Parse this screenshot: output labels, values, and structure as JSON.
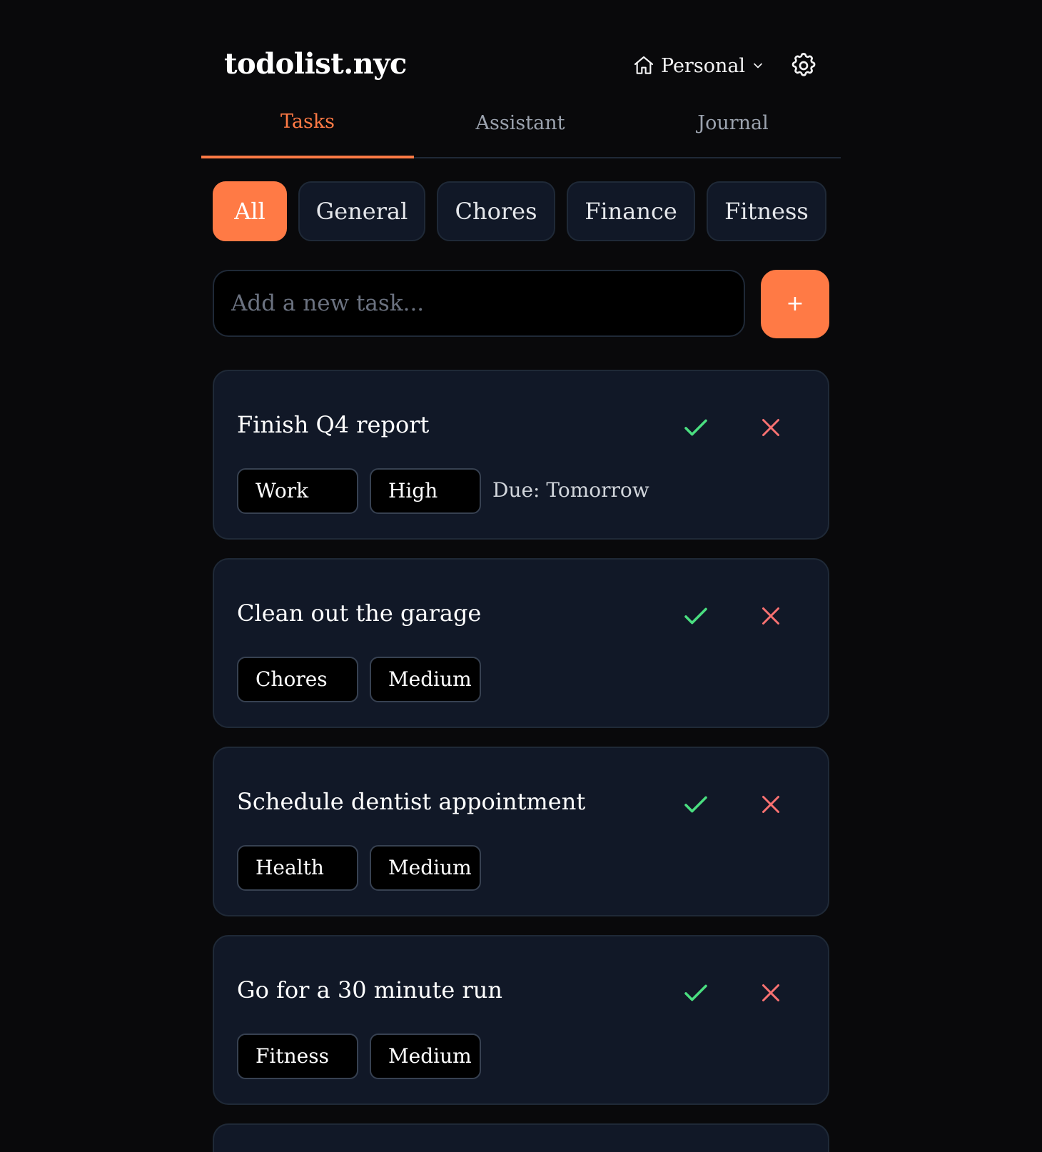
{
  "app": {
    "logo": "todolist.nyc",
    "workspace_label": "Personal",
    "workspace_icon": "home-icon",
    "settings_icon": "gear-icon"
  },
  "tabs": [
    {
      "label": "Tasks",
      "active": true
    },
    {
      "label": "Assistant",
      "active": false
    },
    {
      "label": "Journal",
      "active": false
    }
  ],
  "filters": [
    {
      "label": "All",
      "active": true
    },
    {
      "label": "General",
      "active": false
    },
    {
      "label": "Chores",
      "active": false
    },
    {
      "label": "Finance",
      "active": false
    },
    {
      "label": "Fitness",
      "active": false
    }
  ],
  "new_task": {
    "placeholder": "Add a new task...",
    "value": "",
    "add_label": "+"
  },
  "tasks": [
    {
      "title": "Finish Q4 report",
      "category": "Work",
      "priority": "High",
      "due": "Due: Tomorrow"
    },
    {
      "title": "Clean out the garage",
      "category": "Chores",
      "priority": "Medium",
      "due": ""
    },
    {
      "title": "Schedule dentist appointment",
      "category": "Health",
      "priority": "Medium",
      "due": ""
    },
    {
      "title": "Go for a 30 minute run",
      "category": "Fitness",
      "priority": "Medium",
      "due": ""
    }
  ],
  "colors": {
    "accent": "#ff7a45",
    "background": "#09090b",
    "card": "#111827",
    "complete": "#4ade80",
    "delete": "#f87171"
  }
}
